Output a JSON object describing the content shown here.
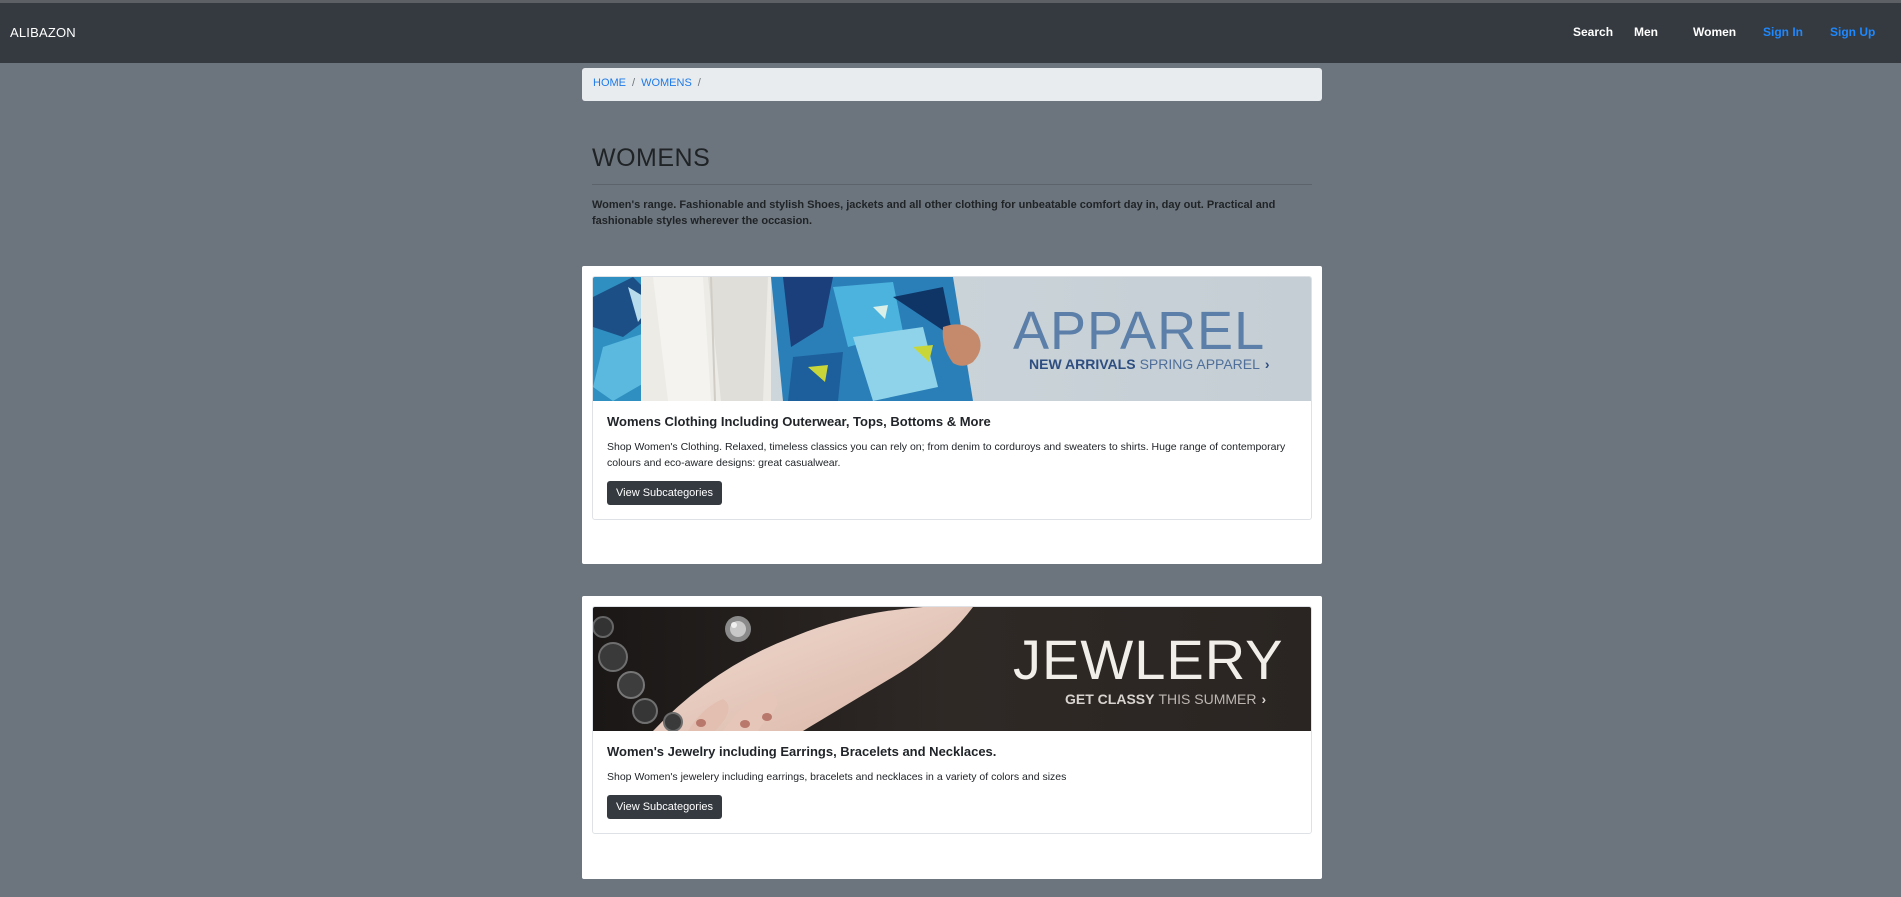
{
  "navbar": {
    "brand": "ALIBAZON",
    "links": [
      {
        "label": "Search"
      },
      {
        "label": "Men"
      },
      {
        "label": "Women"
      },
      {
        "label": "Sign In"
      },
      {
        "label": "Sign Up"
      }
    ]
  },
  "breadcrumb": {
    "items": [
      "HOME",
      "WOMENS"
    ],
    "separator": "/"
  },
  "page": {
    "title": "WOMENS",
    "intro": "Women's range. Fashionable and stylish Shoes, jackets and all other clothing for unbeatable comfort day in, day out. Practical and fashionable styles wherever the occasion."
  },
  "categories": [
    {
      "banner_heading": "APPAREL",
      "banner_sub_strong": "NEW ARRIVALS",
      "banner_sub_light": "SPRING APPAREL",
      "banner_arrow": "›",
      "title": "Womens Clothing Including Outerwear, Tops, Bottoms & More",
      "text": "Shop Women's Clothing. Relaxed, timeless classics you can rely on; from denim to corduroys and sweaters to shirts. Huge range of contemporary colours and eco-aware designs: great casualwear.",
      "button": "View Subcategories"
    },
    {
      "banner_heading": "JEWLERY",
      "banner_sub_strong": "GET CLASSY",
      "banner_sub_light": "THIS SUMMER",
      "banner_arrow": "›",
      "title": "Women's Jewelry including Earrings, Bracelets and Necklaces.",
      "text": "Shop Women's jewelery including earrings, bracelets and necklaces in a variety of colors and sizes",
      "button": "View Subcategories"
    }
  ],
  "colors": {
    "page_bg": "#6c757d",
    "navbar_bg": "#343a40",
    "link_blue": "#1e88ff",
    "button_bg": "#343a40"
  }
}
